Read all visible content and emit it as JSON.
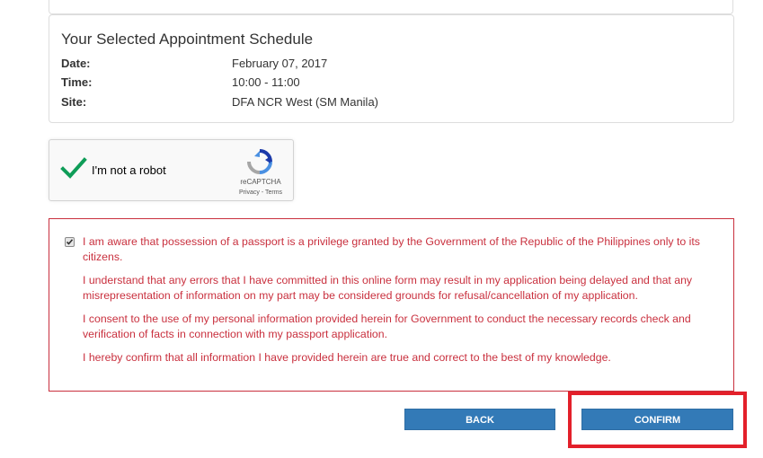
{
  "schedule": {
    "title": "Your Selected Appointment Schedule",
    "date_label": "Date:",
    "date_value": "February 07, 2017",
    "time_label": "Time:",
    "time_value": "10:00 - 11:00",
    "site_label": "Site:",
    "site_value": "DFA NCR West (SM Manila)"
  },
  "recaptcha": {
    "label": "I'm not a robot",
    "brand": "reCAPTCHA",
    "links": "Privacy - Terms",
    "checked": true
  },
  "declarations": {
    "checked": true,
    "paragraphs": [
      "I am aware that possession of a passport is a privilege granted by the Government of the Republic of the Philippines only to its citizens.",
      "I understand that any errors that I have committed in this online form may result in my application being delayed and that any misrepresentation of information on my part may be considered grounds for refusal/cancellation of my application.",
      "I consent to the use of my personal information provided herein for Government to conduct the necessary records check and verification of facts in connection with my passport application.",
      "I hereby confirm that all information I have provided herein are true and correct to the best of my knowledge."
    ]
  },
  "buttons": {
    "back": "BACK",
    "confirm": "CONFIRM"
  },
  "colors": {
    "primary_button": "#337ab7",
    "declaration_text": "#c9303e",
    "highlight": "#e3202a",
    "check_green": "#0f9d58"
  }
}
